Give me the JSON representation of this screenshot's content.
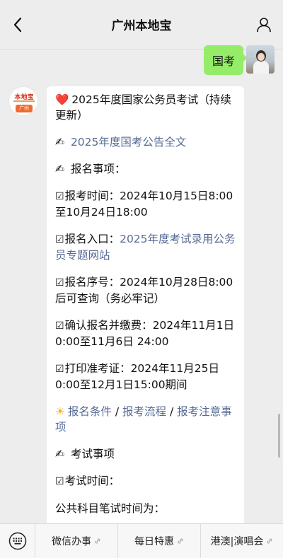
{
  "header": {
    "title": "广州本地宝"
  },
  "outgoing_message": {
    "text": "国考"
  },
  "official_avatar": {
    "logo_text": "本地宝",
    "logo_sub": "广州"
  },
  "article": {
    "title_emoji": "❤️",
    "title": "2025年度国家公务员考试（持续更新）",
    "announcement_emoji": "✍",
    "announcement_link": "2025年度国考公告全文",
    "registration_emoji": "✍",
    "registration_heading": "报名事项：",
    "check_glyph": "☑",
    "reg_time": "报考时间：2024年10月15日8:00至10月24日18:00",
    "entry_label": "报名入口：",
    "entry_link": "2025年度考试录用公务员专题网站",
    "serial_no": "报名序号：2024年10月28日8:00后可查询（务必牢记）",
    "confirm_pay": "确认报名并缴费：2024年11月1日0:00至11月6日 24:00",
    "print_ticket": "打印准考证：2024年11月25日0:00至12月1日15:00期间",
    "sun_emoji": "☀",
    "cond_link": "报名条件",
    "sep1": " / ",
    "flow_link": "报考流程",
    "sep2": " / ",
    "notice_link": "报考注意事项",
    "exam_emoji": "✍",
    "exam_heading": "考试事项",
    "exam_time": "考试时间：",
    "public_subjects": "公共科目笔试时间为："
  },
  "bottom_menu": {
    "items": [
      {
        "label": "微信办事"
      },
      {
        "label": "每日特惠"
      },
      {
        "label": "港澳|演唱会"
      }
    ]
  }
}
